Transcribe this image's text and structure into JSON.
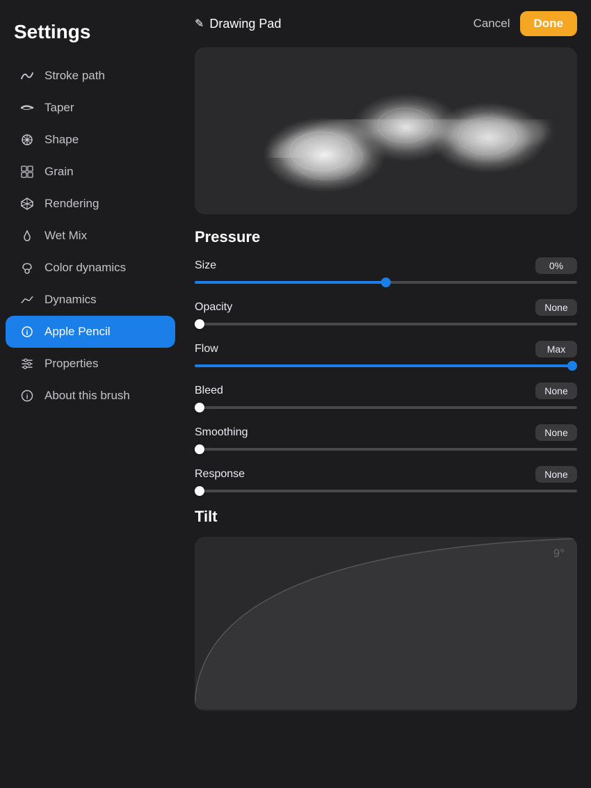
{
  "sidebar": {
    "title": "Settings",
    "items": [
      {
        "id": "stroke-path",
        "label": "Stroke path",
        "icon": "stroke-path-icon"
      },
      {
        "id": "taper",
        "label": "Taper",
        "icon": "taper-icon"
      },
      {
        "id": "shape",
        "label": "Shape",
        "icon": "shape-icon"
      },
      {
        "id": "grain",
        "label": "Grain",
        "icon": "grain-icon"
      },
      {
        "id": "rendering",
        "label": "Rendering",
        "icon": "rendering-icon"
      },
      {
        "id": "wet-mix",
        "label": "Wet Mix",
        "icon": "wet-mix-icon"
      },
      {
        "id": "color-dynamics",
        "label": "Color dynamics",
        "icon": "color-dynamics-icon"
      },
      {
        "id": "dynamics",
        "label": "Dynamics",
        "icon": "dynamics-icon"
      },
      {
        "id": "apple-pencil",
        "label": "Apple Pencil",
        "icon": "apple-pencil-icon",
        "active": true
      },
      {
        "id": "properties",
        "label": "Properties",
        "icon": "properties-icon"
      },
      {
        "id": "about",
        "label": "About this brush",
        "icon": "about-icon"
      }
    ]
  },
  "header": {
    "icon": "✎",
    "title": "Drawing Pad",
    "cancel_label": "Cancel",
    "done_label": "Done"
  },
  "pressure": {
    "section_title": "Pressure",
    "sliders": [
      {
        "label": "Size",
        "value": "0%",
        "fill_pct": 50,
        "thumb_pct": 50
      },
      {
        "label": "Opacity",
        "value": "None",
        "fill_pct": 0,
        "thumb_pct": 0
      },
      {
        "label": "Flow",
        "value": "Max",
        "fill_pct": 100,
        "thumb_pct": 100
      },
      {
        "label": "Bleed",
        "value": "None",
        "fill_pct": 0,
        "thumb_pct": 0
      },
      {
        "label": "Smoothing",
        "value": "None",
        "fill_pct": 0,
        "thumb_pct": 0
      },
      {
        "label": "Response",
        "value": "None",
        "fill_pct": 0,
        "thumb_pct": 0
      }
    ]
  },
  "tilt": {
    "section_title": "Tilt",
    "degree": "9°"
  }
}
